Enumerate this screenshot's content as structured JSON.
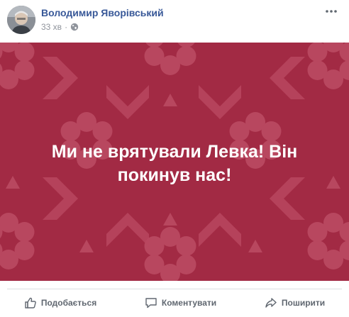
{
  "post": {
    "author": "Володимир Яворівський",
    "time": "33 хв",
    "separator": "·",
    "privacy_icon": "globe-icon",
    "more_icon": "more-options-icon",
    "banner_text": "Ми не врятували Левка! Він покинув нас!",
    "banner_color": "#a22a44",
    "pattern_color": "#b8475f"
  },
  "actions": {
    "like": "Подобається",
    "comment": "Коментувати",
    "share": "Поширити"
  },
  "colors": {
    "author": "#385898",
    "meta": "#90949c",
    "action_text": "#606770"
  }
}
